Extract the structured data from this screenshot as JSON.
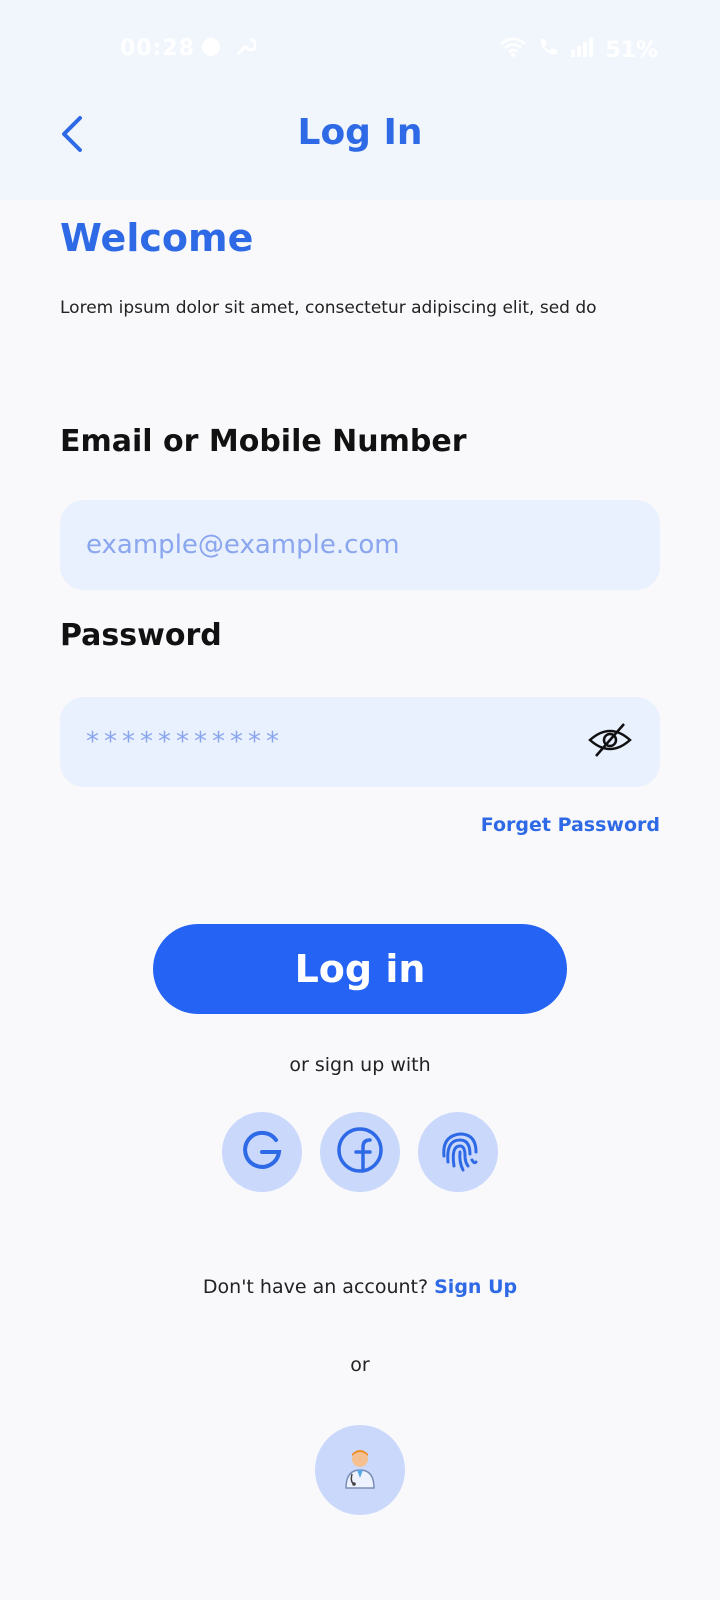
{
  "status_bar": {
    "time": "00:28",
    "battery": "51%",
    "icons_left": [
      "notification-icon",
      "wrench-icon"
    ],
    "icons_right": [
      "wifi-icon",
      "call-icon",
      "signal-icon"
    ]
  },
  "header": {
    "title": "Log In",
    "back_icon": "chevron-left-icon"
  },
  "welcome": {
    "heading": "Welcome",
    "text": "Lorem ipsum dolor sit amet, consectetur adipiscing elit, sed do"
  },
  "form": {
    "email_label": "Email or Mobile Number",
    "email_placeholder": "example@example.com",
    "email_value": "",
    "password_label": "Password",
    "password_value": "***********",
    "password_toggle_icon": "eye-off-icon",
    "forgot_label": "Forget Password",
    "login_label": "Log in"
  },
  "social": {
    "prompt": "or sign up with",
    "options": [
      "google-icon",
      "facebook-icon",
      "fingerprint-icon"
    ]
  },
  "signup": {
    "question": "Don't have an account?",
    "link": "Sign Up"
  },
  "or_text": "or",
  "doctor_login_icon": "doctor-icon",
  "colors": {
    "accent": "#2f6ae6",
    "button": "#2563f4",
    "input_bg": "#e9f0fe",
    "circle_bg": "#cad8fc",
    "header_bg": "#f1f6fd"
  }
}
